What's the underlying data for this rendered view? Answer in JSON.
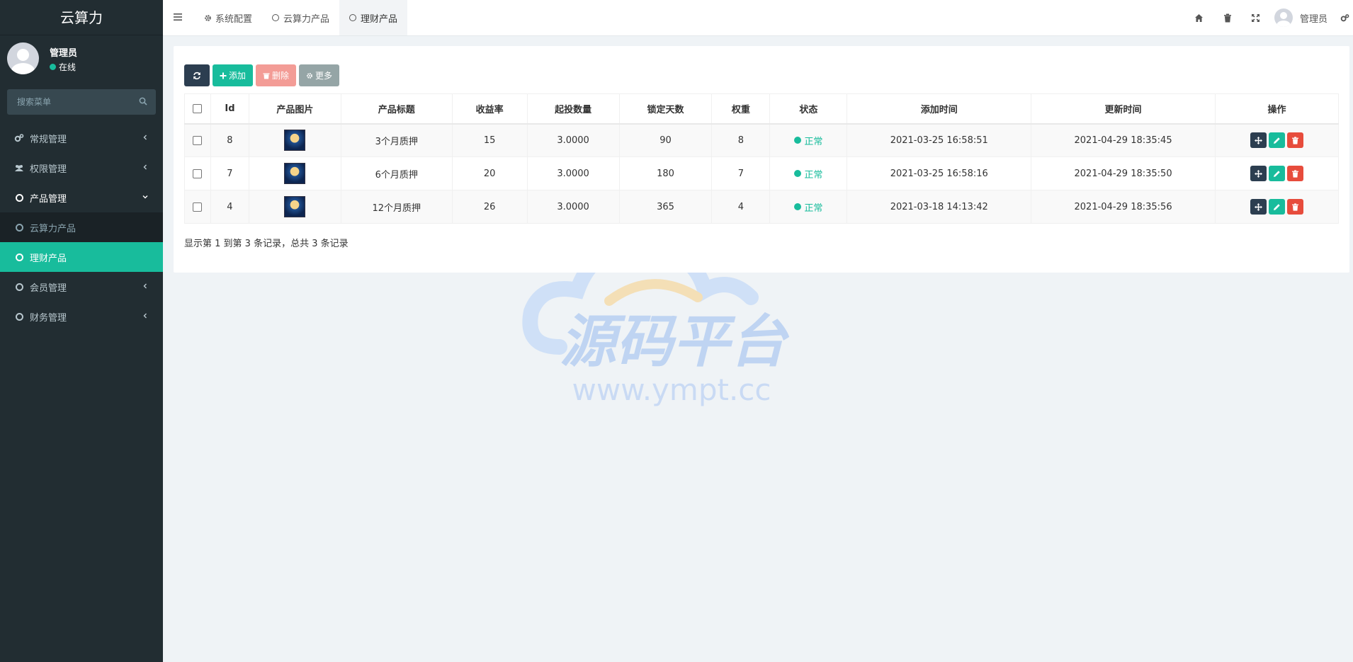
{
  "app": {
    "title": "云算力"
  },
  "user": {
    "name": "管理员",
    "status": "在线"
  },
  "search": {
    "placeholder": "搜索菜单"
  },
  "menu": [
    {
      "label": "常规管理",
      "icon": "cogs-icon"
    },
    {
      "label": "权限管理",
      "icon": "users-icon"
    },
    {
      "label": "产品管理",
      "icon": "circle-icon"
    },
    {
      "label": "云算力产品",
      "icon": "circle-icon"
    },
    {
      "label": "理财产品",
      "icon": "circle-icon"
    },
    {
      "label": "会员管理",
      "icon": "circle-icon"
    },
    {
      "label": "财务管理",
      "icon": "circle-icon"
    }
  ],
  "tabs": [
    {
      "label": "系统配置",
      "icon": "gear-icon"
    },
    {
      "label": "云算力产品",
      "icon": "circle-icon"
    },
    {
      "label": "理财产品",
      "icon": "circle-icon"
    }
  ],
  "topbar": {
    "username": "管理员"
  },
  "toolbar": {
    "add": "添加",
    "delete": "删除",
    "more": "更多"
  },
  "table": {
    "columns": [
      "Id",
      "产品图片",
      "产品标题",
      "收益率",
      "起投数量",
      "锁定天数",
      "权重",
      "状态",
      "添加时间",
      "更新时间",
      "操作"
    ],
    "rows": [
      {
        "id": "8",
        "title": "3个月质押",
        "rate": "15",
        "min": "3.0000",
        "days": "90",
        "weight": "8",
        "status": "正常",
        "created": "2021-03-25 16:58:51",
        "updated": "2021-04-29 18:35:45"
      },
      {
        "id": "7",
        "title": "6个月质押",
        "rate": "20",
        "min": "3.0000",
        "days": "180",
        "weight": "7",
        "status": "正常",
        "created": "2021-03-25 16:58:16",
        "updated": "2021-04-29 18:35:50"
      },
      {
        "id": "4",
        "title": "12个月质押",
        "rate": "26",
        "min": "3.0000",
        "days": "365",
        "weight": "4",
        "status": "正常",
        "created": "2021-03-18 14:13:42",
        "updated": "2021-04-29 18:35:56"
      }
    ]
  },
  "pagination": {
    "summary": "显示第 1 到第 3 条记录，总共 3 条记录"
  },
  "watermark": {
    "title": "源码平台",
    "url": "www.ympt.cc"
  },
  "colors": {
    "sidebar": "#222d32",
    "accent": "#18bc9c",
    "danger": "#e74c3c",
    "dark": "#2c3e50"
  }
}
